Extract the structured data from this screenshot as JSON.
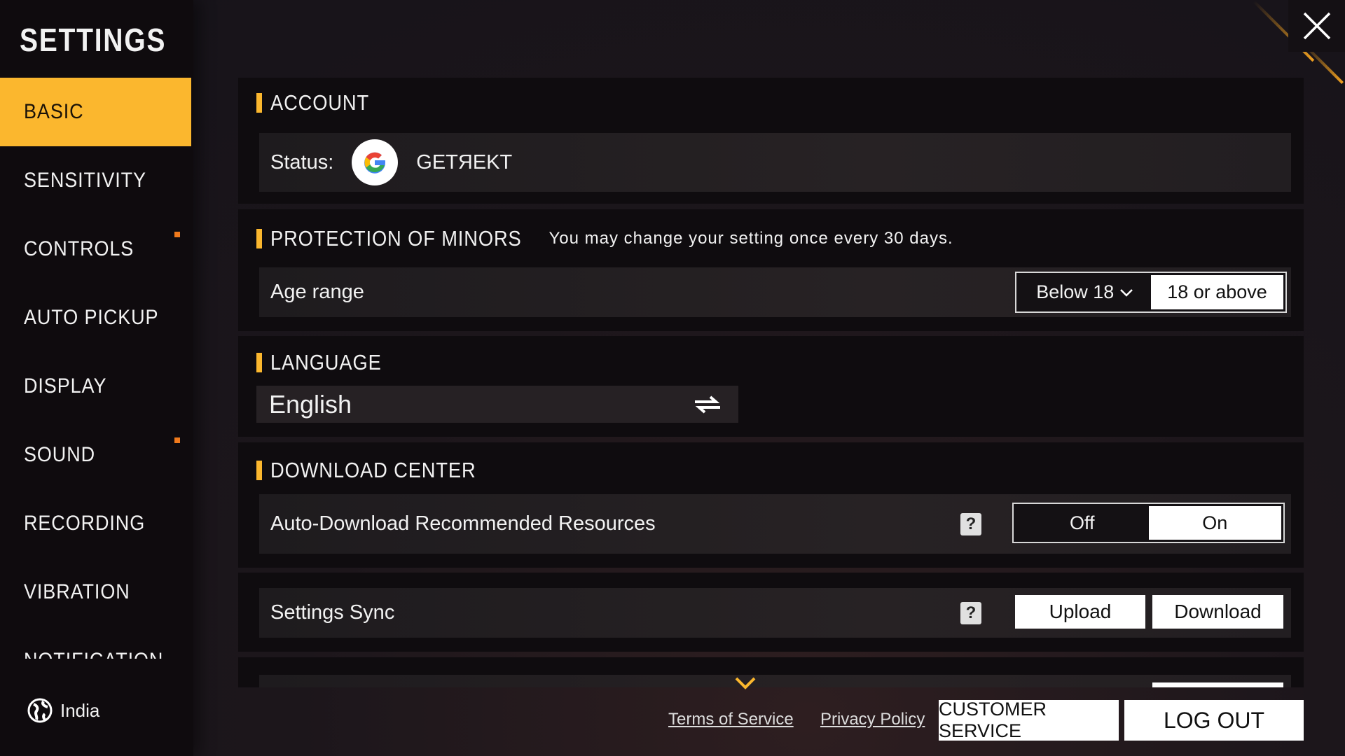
{
  "sidebar": {
    "title": "SETTINGS",
    "items": [
      {
        "label": "BASIC",
        "active": true
      },
      {
        "label": "SENSITIVITY"
      },
      {
        "label": "CONTROLS",
        "badge": true
      },
      {
        "label": "AUTO PICKUP"
      },
      {
        "label": "DISPLAY"
      },
      {
        "label": "SOUND",
        "badge": true
      },
      {
        "label": "RECORDING"
      },
      {
        "label": "VIBRATION"
      },
      {
        "label": "NOTIFICATION"
      }
    ],
    "region": "India"
  },
  "account": {
    "title": "ACCOUNT",
    "status_label": "Status:",
    "provider_icon": "google-icon",
    "username": "GETЯEKT"
  },
  "minors": {
    "title": "PROTECTION OF MINORS",
    "note": "You may change your setting once every 30 days.",
    "age_label": "Age range",
    "options": [
      "Below 18",
      "18 or above"
    ],
    "selected": "18 or above"
  },
  "language": {
    "title": "LANGUAGE",
    "value": "English"
  },
  "download": {
    "title": "DOWNLOAD CENTER",
    "auto_label": "Auto-Download Recommended Resources",
    "options": [
      "Off",
      "On"
    ],
    "selected": "On"
  },
  "sync": {
    "label": "Settings Sync",
    "upload": "Upload",
    "download": "Download"
  },
  "footer": {
    "terms": "Terms of Service",
    "privacy": "Privacy Policy",
    "customer_service": "CUSTOMER SERVICE",
    "logout": "LOG OUT"
  },
  "colors": {
    "accent": "#fbb72e",
    "badge": "#f07a1c"
  }
}
